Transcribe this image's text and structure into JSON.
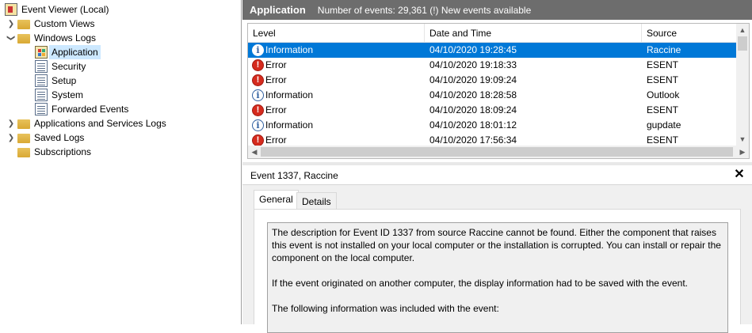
{
  "tree": {
    "items": [
      {
        "label": "Event Viewer (Local)",
        "icon": "event-viewer-icon"
      },
      {
        "label": "Custom Views",
        "icon": "folder-icon"
      },
      {
        "label": "Windows Logs",
        "icon": "folder-icon"
      },
      {
        "label": "Application",
        "icon": "application-log-icon"
      },
      {
        "label": "Security",
        "icon": "log-icon"
      },
      {
        "label": "Setup",
        "icon": "log-icon"
      },
      {
        "label": "System",
        "icon": "log-icon"
      },
      {
        "label": "Forwarded Events",
        "icon": "log-icon"
      },
      {
        "label": "Applications and Services Logs",
        "icon": "folder-icon"
      },
      {
        "label": "Saved Logs",
        "icon": "folder-icon"
      },
      {
        "label": "Subscriptions",
        "icon": "folder-icon"
      }
    ]
  },
  "header": {
    "title": "Application",
    "info": "Number of events: 29,361 (!) New events available"
  },
  "events": {
    "columns": [
      "Level",
      "Date and Time",
      "Source"
    ],
    "rows": [
      {
        "level": "Information",
        "datetime": "04/10/2020 19:28:45",
        "source": "Raccine"
      },
      {
        "level": "Error",
        "datetime": "04/10/2020 19:18:33",
        "source": "ESENT"
      },
      {
        "level": "Error",
        "datetime": "04/10/2020 19:09:24",
        "source": "ESENT"
      },
      {
        "level": "Information",
        "datetime": "04/10/2020 18:28:58",
        "source": "Outlook"
      },
      {
        "level": "Error",
        "datetime": "04/10/2020 18:09:24",
        "source": "ESENT"
      },
      {
        "level": "Information",
        "datetime": "04/10/2020 18:01:12",
        "source": "gupdate"
      },
      {
        "level": "Error",
        "datetime": "04/10/2020 17:56:34",
        "source": "ESENT"
      }
    ]
  },
  "detail": {
    "title": "Event 1337, Raccine",
    "close": "✕",
    "tabs": [
      "General",
      "Details"
    ],
    "description": [
      "The description for Event ID 1337 from source Raccine cannot be found. Either the component that raises this event is not installed on your local computer or the installation is corrupted. You can install or repair the component on the local computer.",
      "If the event originated on another computer, the display information had to be saved with the event.",
      "The following information was included with the event:"
    ]
  },
  "colors": {
    "header_bg": "#6d6d6d",
    "selection": "#0078d7",
    "tree_selection": "#cce8ff",
    "error": "#d52b1e",
    "info": "#2f5fa0"
  }
}
